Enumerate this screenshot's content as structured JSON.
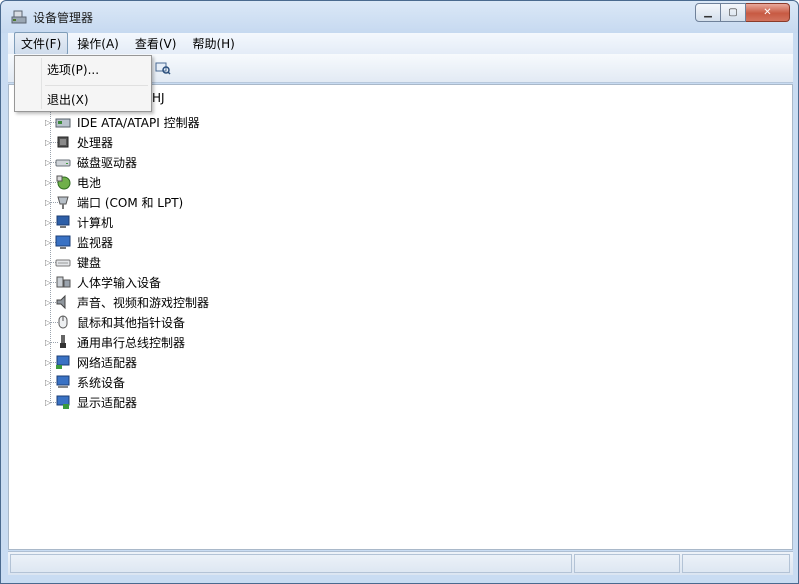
{
  "window": {
    "title": "设备管理器",
    "caption": {
      "minimize_glyph": "▁",
      "maximize_glyph": "▢",
      "close_glyph": "✕"
    }
  },
  "menubar": {
    "items": [
      {
        "label": "文件(F)"
      },
      {
        "label": "操作(A)"
      },
      {
        "label": "查看(V)"
      },
      {
        "label": "帮助(H)"
      }
    ]
  },
  "file_menu": {
    "items": [
      {
        "label": "选项(P)..."
      },
      {
        "label": "退出(X)"
      }
    ]
  },
  "tree": {
    "root_partial": "HJ",
    "nodes": [
      {
        "label": "IDE ATA/ATAPI 控制器",
        "icon": "ide-controller-icon"
      },
      {
        "label": "处理器",
        "icon": "processor-icon"
      },
      {
        "label": "磁盘驱动器",
        "icon": "disk-drive-icon"
      },
      {
        "label": "电池",
        "icon": "battery-icon"
      },
      {
        "label": "端口 (COM 和 LPT)",
        "icon": "port-icon"
      },
      {
        "label": "计算机",
        "icon": "computer-icon"
      },
      {
        "label": "监视器",
        "icon": "monitor-icon"
      },
      {
        "label": "键盘",
        "icon": "keyboard-icon"
      },
      {
        "label": "人体学输入设备",
        "icon": "hid-icon"
      },
      {
        "label": "声音、视频和游戏控制器",
        "icon": "sound-icon"
      },
      {
        "label": "鼠标和其他指针设备",
        "icon": "mouse-icon"
      },
      {
        "label": "通用串行总线控制器",
        "icon": "usb-icon"
      },
      {
        "label": "网络适配器",
        "icon": "network-adapter-icon"
      },
      {
        "label": "系统设备",
        "icon": "system-device-icon"
      },
      {
        "label": "显示适配器",
        "icon": "display-adapter-icon"
      }
    ]
  }
}
